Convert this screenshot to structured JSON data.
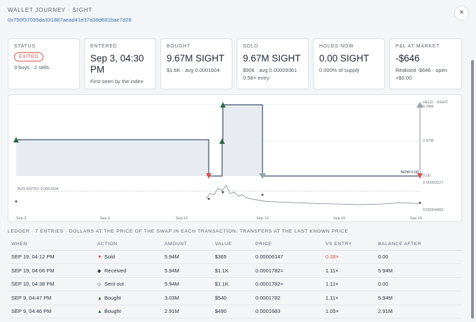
{
  "header": {
    "title": "WALLET JOURNEY · SIGHT",
    "address": "0x750f37035da331887aead41e37a39d681bae7d28",
    "close_glyph": "×"
  },
  "cards": {
    "status": {
      "label": "STATUS",
      "badge": "EXITED",
      "sub": "3 buys · 2 sells"
    },
    "entered": {
      "label": "ENTERED",
      "value": "Sep 3, 04:30 PM",
      "sub": "First seen by the index"
    },
    "bought": {
      "label": "BOUGHT",
      "value": "9.67M SIGHT",
      "sub": "$1.6K · avg 0.0001604"
    },
    "sold": {
      "label": "SOLD",
      "value": "9.67M SIGHT",
      "sub": "$906 · avg 0.00009361 · 0.58× entry"
    },
    "holds": {
      "label": "HOLDS NOW",
      "value": "0.00 SIGHT",
      "sub": "0.000% of supply"
    },
    "pnl": {
      "label": "P&L AT MARKET",
      "value": "-$646",
      "sub": "Realised -$646 · open +$0.00",
      "color": "#d9534f"
    }
  },
  "chart_data": {
    "type": "line",
    "x_ticks": [
      "Sep 3",
      "Sep 6",
      "Sep 10",
      "Sep 13",
      "Sep 16",
      "Sep 19"
    ],
    "held": {
      "label": "HELD · SIGHT",
      "ticks": [
        "5.94M",
        "2.97M",
        "0.00"
      ],
      "ylim": [
        0,
        5.94
      ],
      "now_label": "NOW 0.00",
      "steps": [
        {
          "t": 0.0,
          "v": 3.03
        },
        {
          "t": 0.477,
          "v": 0.0
        },
        {
          "t": 0.51,
          "v": 2.91
        },
        {
          "t": 0.512,
          "v": 5.94
        },
        {
          "t": 0.61,
          "v": 0.0
        },
        {
          "t": 1.0,
          "v": 0.0
        }
      ],
      "events": [
        {
          "t": 0.0,
          "v": 3.03,
          "kind": "buy"
        },
        {
          "t": 0.477,
          "v": 0.0,
          "kind": "sell"
        },
        {
          "t": 0.51,
          "v": 2.91,
          "kind": "buy"
        },
        {
          "t": 0.512,
          "v": 5.94,
          "kind": "buy"
        },
        {
          "t": 0.61,
          "v": 0.0,
          "kind": "sent"
        },
        {
          "t": 1.0,
          "v": 5.94,
          "kind": "received"
        },
        {
          "t": 1.0,
          "v": 0.0,
          "kind": "sell"
        }
      ],
      "colors": {
        "buy": "#2f6b4a",
        "sell": "#d9534f",
        "sent": "#9aa3ad",
        "received": "#9aa3ad",
        "line": "#3a4f6b",
        "fill": "#e8ebef"
      }
    },
    "price": {
      "avg_entry_label": "AVG ENTRY 0.0001604",
      "ticks": [
        "0.00002227",
        "0.00004483"
      ],
      "x": [
        0.47,
        0.48,
        0.49,
        0.5,
        0.51,
        0.52,
        0.53,
        0.54,
        0.55,
        0.56,
        0.57,
        0.58,
        0.6,
        0.62,
        0.65,
        0.7,
        0.75,
        0.8,
        0.85,
        0.9,
        0.95,
        1.0
      ],
      "y": [
        0.3,
        0.5,
        0.45,
        0.7,
        0.6,
        0.8,
        0.5,
        0.55,
        0.4,
        0.45,
        0.35,
        0.3,
        0.25,
        0.2,
        0.18,
        0.15,
        0.12,
        0.1,
        0.08,
        0.1,
        0.15,
        0.12
      ],
      "color": "#8b9299"
    }
  },
  "ledger": {
    "title": "LEDGER · 7 ENTRIES · DOLLARS AT THE PRICE OF THE SWAP IN EACH TRANSACTION; TRANSFERS AT THE LAST KNOWN PRICE",
    "columns": [
      "WHEN",
      "ACTION",
      "AMOUNT",
      "VALUE",
      "PRICE",
      "VS ENTRY",
      "BALANCE AFTER"
    ],
    "rows": [
      {
        "when": "SEP 19, 04:12 PM",
        "sym": "▼",
        "kind": "sold",
        "action": "Sold",
        "amount": "5.94M",
        "value": "$365",
        "price": "0.00006147",
        "vs": "0.38×",
        "vs_neg": true,
        "balance": "0.00"
      },
      {
        "when": "SEP 19, 04:06 PM",
        "sym": "◆",
        "kind": "recv",
        "action": "Received",
        "amount": "5.94M",
        "value": "$1.1K",
        "price": "0.0001782≈",
        "vs": "1.11×",
        "vs_neg": false,
        "balance": "5.94M"
      },
      {
        "when": "SEP 10, 04:38 PM",
        "sym": "◇",
        "kind": "recv",
        "action": "Sent out",
        "amount": "5.94M",
        "value": "$1.1K",
        "price": "0.0001782≈",
        "vs": "1.11×",
        "vs_neg": false,
        "balance": "0.00"
      },
      {
        "when": "SEP 9, 04:47 PM",
        "sym": "▲",
        "kind": "bought",
        "action": "Bought",
        "amount": "3.03M",
        "value": "$540",
        "price": "0.0001782",
        "vs": "1.11×",
        "vs_neg": false,
        "balance": "5.94M"
      },
      {
        "when": "SEP 9, 04:46 PM",
        "sym": "▲",
        "kind": "bought",
        "action": "Bought",
        "amount": "2.91M",
        "value": "$490",
        "price": "0.0001683",
        "vs": "1.05×",
        "vs_neg": false,
        "balance": "2.91M"
      }
    ]
  }
}
